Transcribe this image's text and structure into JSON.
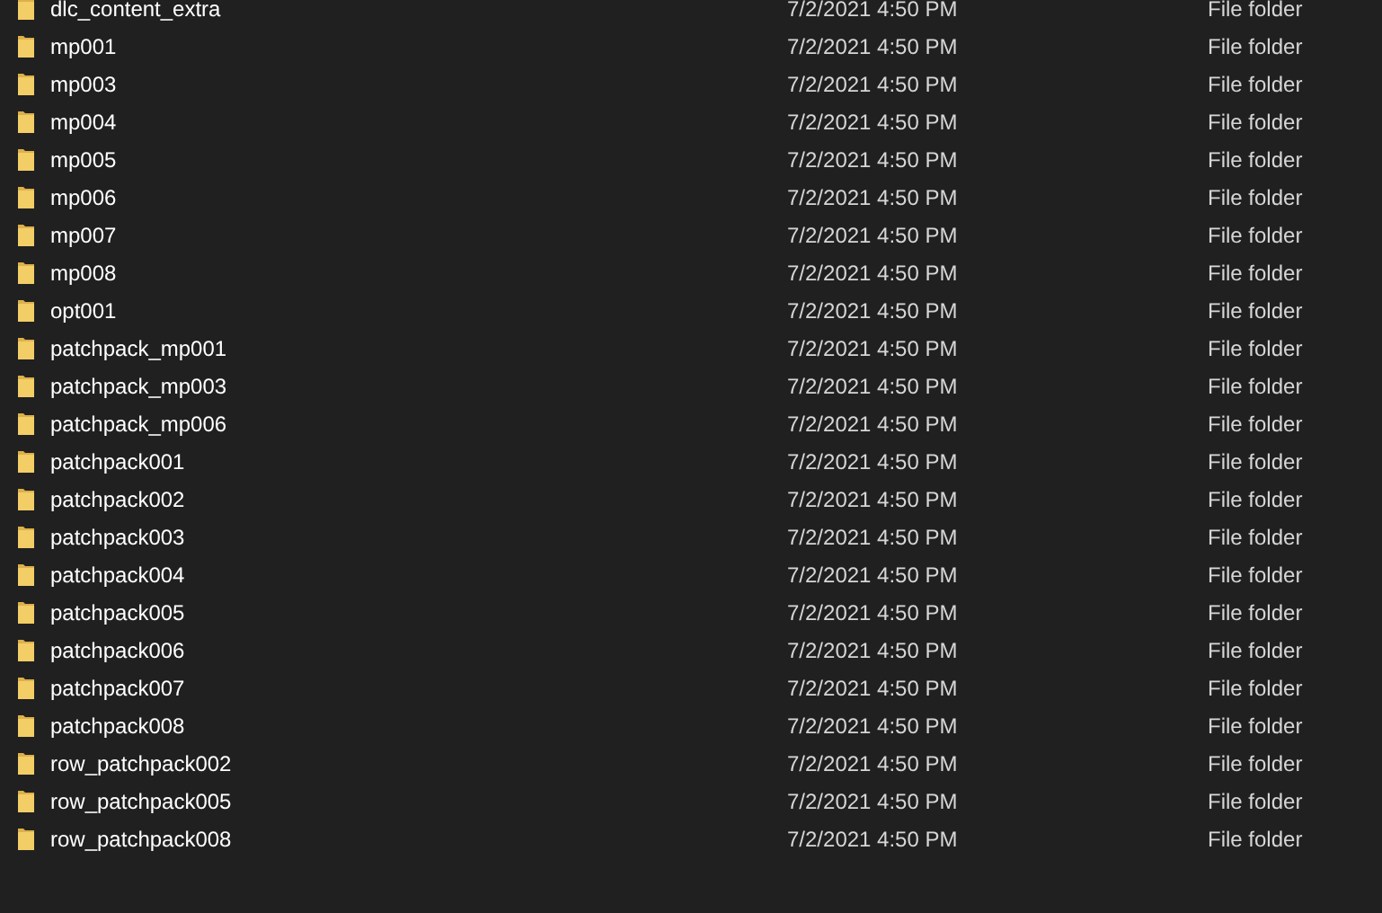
{
  "files": [
    {
      "name": "dlc_content_extra",
      "date_modified": "7/2/2021 4:50 PM",
      "type": "File folder"
    },
    {
      "name": "mp001",
      "date_modified": "7/2/2021 4:50 PM",
      "type": "File folder"
    },
    {
      "name": "mp003",
      "date_modified": "7/2/2021 4:50 PM",
      "type": "File folder"
    },
    {
      "name": "mp004",
      "date_modified": "7/2/2021 4:50 PM",
      "type": "File folder"
    },
    {
      "name": "mp005",
      "date_modified": "7/2/2021 4:50 PM",
      "type": "File folder"
    },
    {
      "name": "mp006",
      "date_modified": "7/2/2021 4:50 PM",
      "type": "File folder"
    },
    {
      "name": "mp007",
      "date_modified": "7/2/2021 4:50 PM",
      "type": "File folder"
    },
    {
      "name": "mp008",
      "date_modified": "7/2/2021 4:50 PM",
      "type": "File folder"
    },
    {
      "name": "opt001",
      "date_modified": "7/2/2021 4:50 PM",
      "type": "File folder"
    },
    {
      "name": "patchpack_mp001",
      "date_modified": "7/2/2021 4:50 PM",
      "type": "File folder"
    },
    {
      "name": "patchpack_mp003",
      "date_modified": "7/2/2021 4:50 PM",
      "type": "File folder"
    },
    {
      "name": "patchpack_mp006",
      "date_modified": "7/2/2021 4:50 PM",
      "type": "File folder"
    },
    {
      "name": "patchpack001",
      "date_modified": "7/2/2021 4:50 PM",
      "type": "File folder"
    },
    {
      "name": "patchpack002",
      "date_modified": "7/2/2021 4:50 PM",
      "type": "File folder"
    },
    {
      "name": "patchpack003",
      "date_modified": "7/2/2021 4:50 PM",
      "type": "File folder"
    },
    {
      "name": "patchpack004",
      "date_modified": "7/2/2021 4:50 PM",
      "type": "File folder"
    },
    {
      "name": "patchpack005",
      "date_modified": "7/2/2021 4:50 PM",
      "type": "File folder"
    },
    {
      "name": "patchpack006",
      "date_modified": "7/2/2021 4:50 PM",
      "type": "File folder"
    },
    {
      "name": "patchpack007",
      "date_modified": "7/2/2021 4:50 PM",
      "type": "File folder"
    },
    {
      "name": "patchpack008",
      "date_modified": "7/2/2021 4:50 PM",
      "type": "File folder"
    },
    {
      "name": "row_patchpack002",
      "date_modified": "7/2/2021 4:50 PM",
      "type": "File folder"
    },
    {
      "name": "row_patchpack005",
      "date_modified": "7/2/2021 4:50 PM",
      "type": "File folder"
    },
    {
      "name": "row_patchpack008",
      "date_modified": "7/2/2021 4:50 PM",
      "type": "File folder"
    }
  ]
}
